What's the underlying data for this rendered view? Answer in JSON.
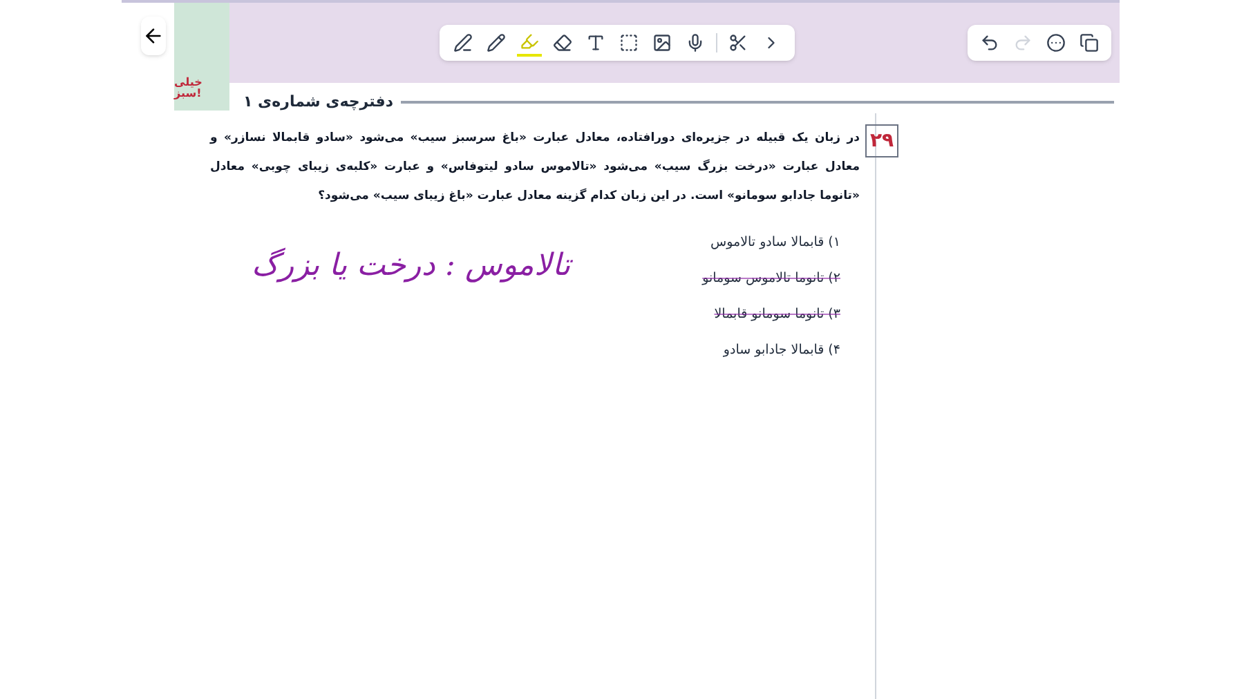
{
  "toolbar": {
    "tools": [
      {
        "kind": "pen",
        "selected": false
      },
      {
        "kind": "pencil",
        "selected": false
      },
      {
        "kind": "highlighter",
        "selected": true
      },
      {
        "kind": "eraser",
        "selected": false
      },
      {
        "kind": "text",
        "selected": false
      },
      {
        "kind": "select",
        "selected": false
      },
      {
        "kind": "image",
        "selected": false
      },
      {
        "kind": "mic",
        "selected": false
      },
      {
        "kind": "lasso",
        "selected": false
      },
      {
        "kind": "more",
        "selected": false
      }
    ]
  },
  "actions": [
    {
      "kind": "undo",
      "disabled": false
    },
    {
      "kind": "redo",
      "disabled": true
    },
    {
      "kind": "menu",
      "disabled": false
    },
    {
      "kind": "pages",
      "disabled": false
    }
  ],
  "logo": {
    "text": "خیلی سبز!"
  },
  "booklet_title": "دفترچه‌ی شماره‌ی ۱",
  "question": {
    "number": "۲۹",
    "text": "در زبان یک قبیله در جزیره‌ای دورافتاده، معادل عبارت «باغ سرسبز سیب» می‌شود «سادو قابمالا نسازر» و معادل عبارت «درخت بزرگ سیب» می‌شود «تالاموس سادو لیتوفاس» و عبارت «کلبه‌ی زیبای چوبی» معادل «تانوما جادابو سومانو» است. در این زبان کدام گزینه معادل عبارت «باغ زیبای سیب» می‌شود؟",
    "options": [
      {
        "text": "۱) قابمالا سادو تالاموس",
        "struck": false
      },
      {
        "text": "۲) تانوما تالاموس سومانو",
        "struck": true
      },
      {
        "text": "۳) تانوما سومانو قابمالا",
        "struck": true
      },
      {
        "text": "۴) قابمالا جادابو سادو",
        "struck": false
      }
    ]
  },
  "handwritten_note": "تالاموس : درخت یا بزرگ"
}
